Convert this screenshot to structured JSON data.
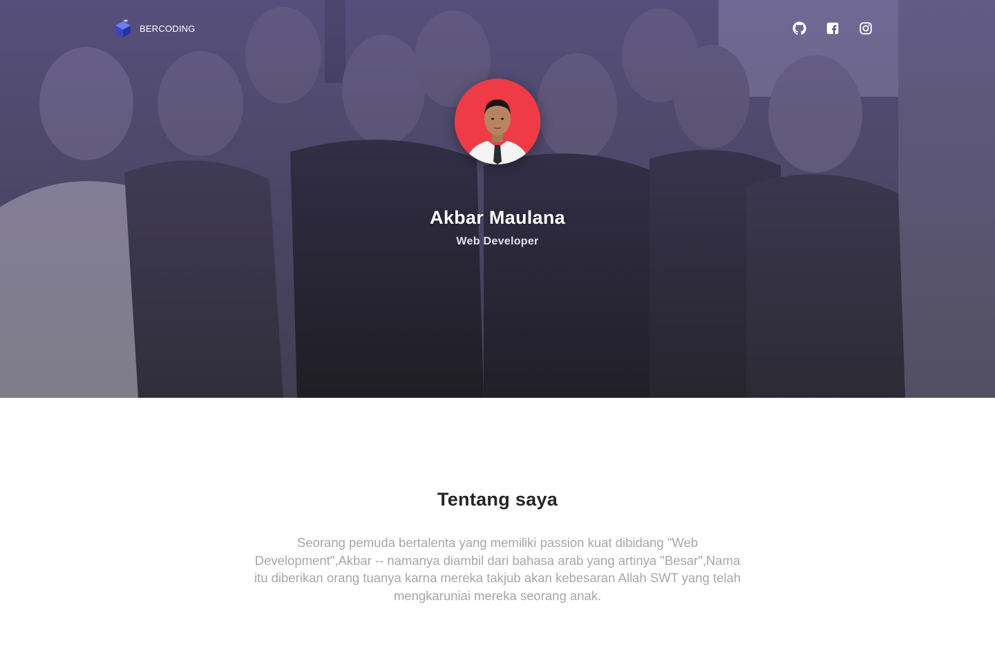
{
  "nav": {
    "brand_name": "BERCODING",
    "brand_icon": "bercoding-cube-logo",
    "social": [
      {
        "name": "github",
        "icon": "github-icon"
      },
      {
        "name": "facebook",
        "icon": "facebook-square-icon"
      },
      {
        "name": "instagram",
        "icon": "instagram-icon"
      }
    ]
  },
  "hero": {
    "name": "Akbar Maulana",
    "role": "Web Developer",
    "avatar_background": "#ef3b45",
    "overlay_color": "#5a5088"
  },
  "about": {
    "title": "Tentang saya",
    "text": "Seorang pemuda bertalenta yang memiliki passion kuat dibidang \"Web Development\",Akbar -- namanya diambil dari bahasa arab yang artinya \"Besar\",Nama itu diberikan orang tuanya karna mereka takjub akan kebesaran Allah SWT yang telah mengkaruniai mereka seorang anak."
  }
}
